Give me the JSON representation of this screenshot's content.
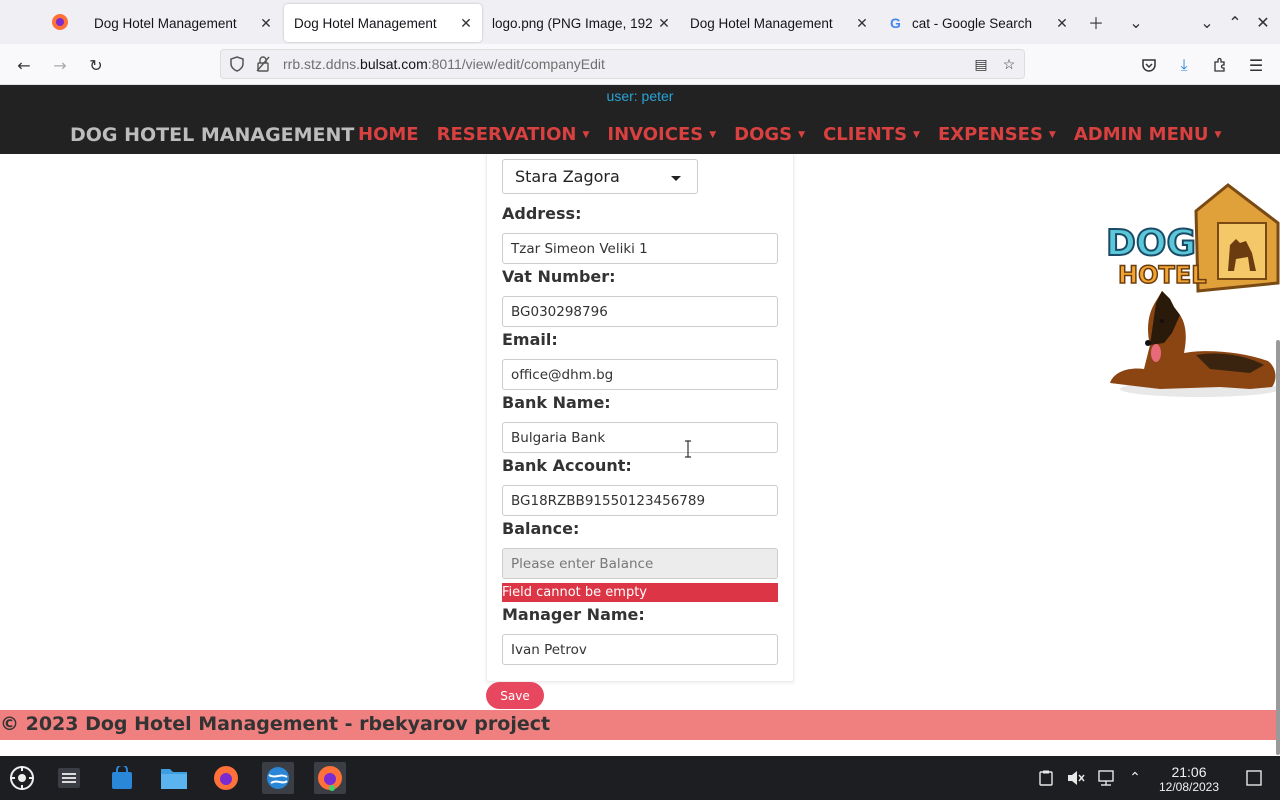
{
  "browser": {
    "tabs": [
      {
        "title": "Dog Hotel Management",
        "active": false
      },
      {
        "title": "Dog Hotel Management",
        "active": true
      },
      {
        "title": "logo.png (PNG Image, 192",
        "active": false
      },
      {
        "title": "Dog Hotel Management",
        "active": false
      },
      {
        "title": "cat - Google Search",
        "active": false
      }
    ],
    "url_prefix": "rrb.stz.ddns.",
    "url_domain": "bulsat.com",
    "url_suffix": ":8011/view/edit/companyEdit"
  },
  "site": {
    "user_line": "user: peter",
    "brand": "DOG HOTEL MANAGEMENT",
    "menu": [
      {
        "label": "HOME",
        "dropdown": false
      },
      {
        "label": "RESERVATION",
        "dropdown": true
      },
      {
        "label": "INVOICES",
        "dropdown": true
      },
      {
        "label": "DOGS",
        "dropdown": true
      },
      {
        "label": "CLIENTS",
        "dropdown": true
      },
      {
        "label": "EXPENSES",
        "dropdown": true
      },
      {
        "label": "ADMIN MENU",
        "dropdown": true
      }
    ],
    "accent_color": "#d94040"
  },
  "form": {
    "city": "Stara Zagora",
    "address_label": "Address:",
    "address": "Tzar Simeon Veliki 1",
    "vat_label": "Vat Number:",
    "vat": "BG030298796",
    "email_label": "Email:",
    "email": "office@dhm.bg",
    "bank_name_label": "Bank Name:",
    "bank_name": "Bulgaria Bank",
    "bank_account_label": "Bank Account:",
    "bank_account": "BG18RZBB91550123456789",
    "balance_label": "Balance:",
    "balance_placeholder": "Please enter Balance",
    "balance_error": "Field cannot be empty",
    "manager_label": "Manager Name:",
    "manager": "Ivan Petrov",
    "save_label": "Save"
  },
  "logo": {
    "text_dog": "DOG",
    "text_hotel": "HOTEL"
  },
  "footer": {
    "text": "© 2023 Dog Hotel Management - rbekyarov project"
  },
  "taskbar": {
    "time": "21:06",
    "date": "12/08/2023"
  }
}
